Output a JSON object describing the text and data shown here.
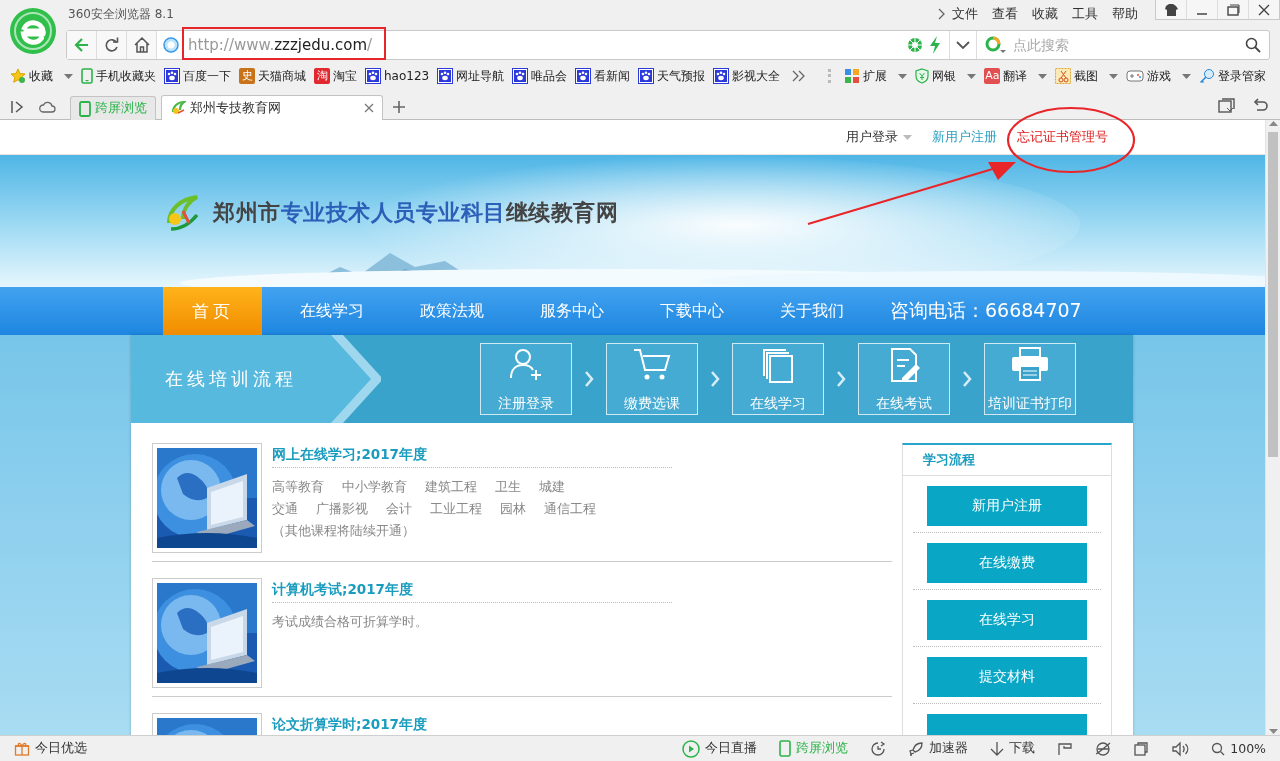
{
  "browser": {
    "title": "360安全浏览器 8.1",
    "menu": [
      "文件",
      "查看",
      "收藏",
      "工具",
      "帮助"
    ],
    "address": {
      "scheme": "http://www.",
      "host": "zzzjedu.com",
      "path": "/"
    },
    "search": {
      "placeholder": "点此搜索"
    },
    "bookmarks": [
      {
        "label": "收藏",
        "kind": "star",
        "dropdown": true
      },
      {
        "label": "手机收藏夹",
        "kind": "phone",
        "dropdown": false
      },
      {
        "label": "百度一下",
        "kind": "paw",
        "dropdown": false
      },
      {
        "label": "天猫商城",
        "kind": "glyph",
        "glyph": "史",
        "color": "#c8731a",
        "dropdown": false
      },
      {
        "label": "淘宝",
        "kind": "glyph",
        "glyph": "淘",
        "color": "#e0282e",
        "dropdown": false
      },
      {
        "label": "hao123",
        "kind": "paw",
        "dropdown": false
      },
      {
        "label": "网址导航",
        "kind": "paw",
        "dropdown": false
      },
      {
        "label": "唯品会",
        "kind": "paw",
        "dropdown": false
      },
      {
        "label": "看新闻",
        "kind": "paw",
        "dropdown": false
      },
      {
        "label": "天气预报",
        "kind": "paw",
        "dropdown": false
      },
      {
        "label": "影视大全",
        "kind": "paw",
        "dropdown": false
      }
    ],
    "tools": [
      {
        "label": "扩展",
        "kind": "grid",
        "dropdown": true
      },
      {
        "label": "网银",
        "kind": "shield",
        "dropdown": true
      },
      {
        "label": "翻译",
        "kind": "glyph",
        "glyph": "Aa",
        "color": "#e05050",
        "dropdown": true
      },
      {
        "label": "截图",
        "kind": "scissors",
        "dropdown": true
      },
      {
        "label": "游戏",
        "kind": "gamepad",
        "dropdown": true
      },
      {
        "label": "登录管家",
        "kind": "key",
        "dropdown": false
      }
    ],
    "tabs": [
      {
        "label": "跨屏浏览",
        "kind": "phone",
        "selected": false
      },
      {
        "label": "郑州专技教育网",
        "kind": "site",
        "selected": true
      }
    ]
  },
  "page": {
    "top_links": [
      {
        "label": "用户登录",
        "dropdown": true,
        "color": "#333333"
      },
      {
        "label": "新用户注册",
        "dropdown": false,
        "color": "#2a9fbf"
      },
      {
        "label": "忘记证书管理号",
        "dropdown": false,
        "color": "#e02020"
      }
    ],
    "site_title": [
      {
        "text": "郑州市",
        "highlight": false
      },
      {
        "text": "专业技术人员专业科目",
        "highlight": true
      },
      {
        "text": "继续教育网",
        "highlight": false
      }
    ],
    "nav": [
      {
        "label": "首页",
        "selected": true
      },
      {
        "label": "在线学习",
        "selected": false
      },
      {
        "label": "政策法规",
        "selected": false
      },
      {
        "label": "服务中心",
        "selected": false
      },
      {
        "label": "下载中心",
        "selected": false
      },
      {
        "label": "关于我们",
        "selected": false
      }
    ],
    "hotline": "咨询电话：66684707",
    "flow": {
      "title": "在线培训流程",
      "steps": [
        {
          "label": "注册登录",
          "kind": "user"
        },
        {
          "label": "缴费选课",
          "kind": "cart"
        },
        {
          "label": "在线学习",
          "kind": "pages"
        },
        {
          "label": "在线考试",
          "kind": "exam"
        },
        {
          "label": "培训证书打印",
          "kind": "printer"
        }
      ]
    },
    "articles": [
      {
        "title": "网上在线学习;2017年度",
        "tags": [
          [
            "高等教育",
            "中小学教育",
            "建筑工程",
            "卫生",
            "城建"
          ],
          [
            "交通",
            "广播影视",
            "会计",
            "工业工程",
            "园林",
            "通信工程"
          ]
        ],
        "note": "（其他课程将陆续开通）"
      },
      {
        "title": "计算机考试;2017年度",
        "note": "考试成绩合格可折算学时。"
      },
      {
        "title": "论文折算学时;2017年度"
      }
    ],
    "sidebar": {
      "title": "学习流程",
      "buttons": [
        "新用户注册",
        "在线缴费",
        "在线学习",
        "提交材料"
      ]
    }
  },
  "status_bar": {
    "left": "今日优选",
    "items": [
      {
        "label": "今日直播",
        "kind": "play"
      },
      {
        "label": "跨屏浏览",
        "kind": "phone"
      },
      {
        "kind": "clock"
      },
      {
        "label": "加速器",
        "kind": "rocket"
      },
      {
        "label": "下载",
        "kind": "download"
      },
      {
        "kind": "flag"
      },
      {
        "kind": "ie"
      },
      {
        "kind": "window"
      },
      {
        "kind": "speaker"
      },
      {
        "label": "100%",
        "kind": "zoom"
      }
    ]
  }
}
